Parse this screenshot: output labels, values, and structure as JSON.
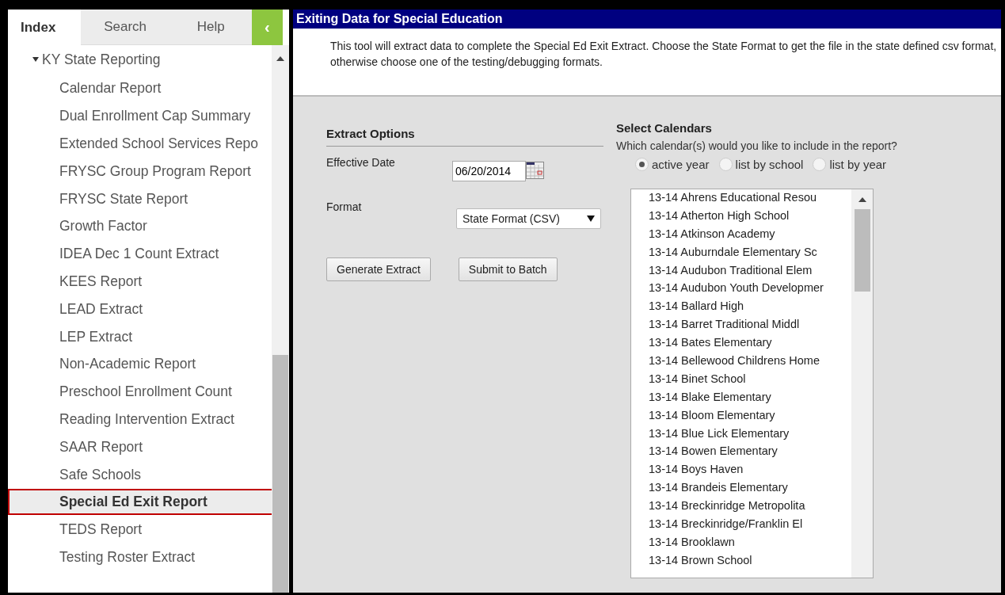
{
  "sidebar": {
    "tabs": [
      {
        "label": "Index",
        "selected": true
      },
      {
        "label": "Search",
        "selected": false
      },
      {
        "label": "Help",
        "selected": false
      }
    ],
    "collapse_button": "‹",
    "tree": {
      "label": "KY State Reporting",
      "expanded": true,
      "children": [
        {
          "label": "Calendar Report",
          "selected": false
        },
        {
          "label": "Dual Enrollment Cap Summary",
          "selected": false
        },
        {
          "label": "Extended School Services Repo",
          "selected": false
        },
        {
          "label": "FRYSC Group Program Report",
          "selected": false
        },
        {
          "label": "FRYSC State Report",
          "selected": false
        },
        {
          "label": "Growth Factor",
          "selected": false
        },
        {
          "label": "IDEA Dec 1 Count Extract",
          "selected": false
        },
        {
          "label": "KEES Report",
          "selected": false
        },
        {
          "label": "LEAD Extract",
          "selected": false
        },
        {
          "label": "LEP Extract",
          "selected": false
        },
        {
          "label": "Non-Academic Report",
          "selected": false
        },
        {
          "label": "Preschool Enrollment Count",
          "selected": false
        },
        {
          "label": "Reading Intervention Extract",
          "selected": false
        },
        {
          "label": "SAAR Report",
          "selected": false
        },
        {
          "label": "Safe Schools",
          "selected": false
        },
        {
          "label": "Special Ed Exit Report",
          "selected": true
        },
        {
          "label": "TEDS Report",
          "selected": false
        },
        {
          "label": "Testing Roster Extract",
          "selected": false
        }
      ]
    }
  },
  "main": {
    "title": "Exiting Data for Special Education",
    "description": "This tool will extract data to complete the Special Ed Exit Extract. Choose the State Format to get the file in the state defined csv format, otherwise choose one of the testing/debugging formats.",
    "extract_options": {
      "heading": "Extract Options",
      "effective_date": {
        "label": "Effective Date",
        "value": "06/20/2014"
      },
      "format": {
        "label": "Format",
        "value": "State Format (CSV)"
      },
      "buttons": [
        "Generate Extract",
        "Submit to Batch"
      ]
    },
    "select_calendars": {
      "heading": "Select Calendars",
      "question": "Which calendar(s) would you like to include in the report?",
      "options": [
        {
          "label": "active year",
          "selected": true
        },
        {
          "label": "list by school",
          "selected": false
        },
        {
          "label": "list by year",
          "selected": false
        }
      ],
      "calendars": [
        "13-14 Ahrens Educational Resou",
        "13-14 Atherton High School",
        "13-14 Atkinson Academy",
        "13-14 Auburndale Elementary Sc",
        "13-14 Audubon Traditional Elem",
        "13-14 Audubon Youth Developmer",
        "13-14 Ballard High",
        "13-14 Barret Traditional Middl",
        "13-14 Bates Elementary",
        "13-14 Bellewood Childrens Home",
        "13-14 Binet School",
        "13-14 Blake Elementary",
        "13-14 Bloom Elementary",
        "13-14 Blue Lick Elementary",
        "13-14 Bowen Elementary",
        "13-14 Boys Haven",
        "13-14 Brandeis Elementary",
        "13-14 Breckinridge Metropolita",
        "13-14 Breckinridge/Franklin El",
        "13-14 Brooklawn",
        "13-14 Brown School"
      ]
    }
  }
}
